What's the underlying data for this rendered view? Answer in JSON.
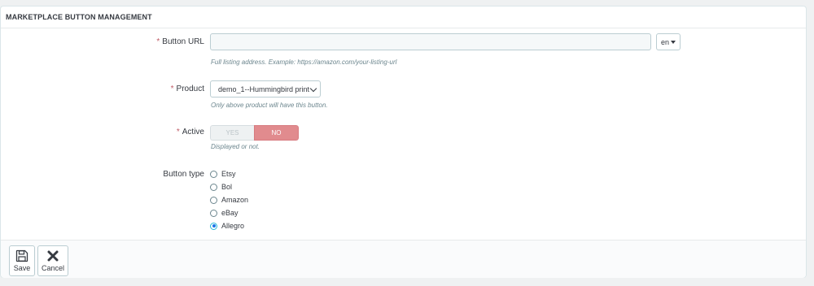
{
  "panel": {
    "heading": "MARKETPLACE BUTTON MANAGEMENT"
  },
  "form": {
    "required_mark": "*",
    "button_url": {
      "label": "Button URL",
      "value": "",
      "placeholder": "",
      "lang": "en",
      "help": "Full listing address. Example: https://amazon.com/your-listing-url"
    },
    "product": {
      "label": "Product",
      "selected": "demo_1--Hummingbird print",
      "help": "Only above product will have this button."
    },
    "active": {
      "label": "Active",
      "yes": "YES",
      "no": "NO",
      "value": "no",
      "help": "Displayed or not."
    },
    "button_type": {
      "label": "Button type",
      "options": [
        "Etsy",
        "Bol",
        "Amazon",
        "eBay",
        "Allegro"
      ],
      "selected": "Allegro"
    }
  },
  "footer": {
    "save_label": "Save",
    "cancel_label": "Cancel"
  },
  "colors": {
    "accent": "#25b9d7",
    "danger_switch": "#e18b8e",
    "required": "#c05c67"
  }
}
